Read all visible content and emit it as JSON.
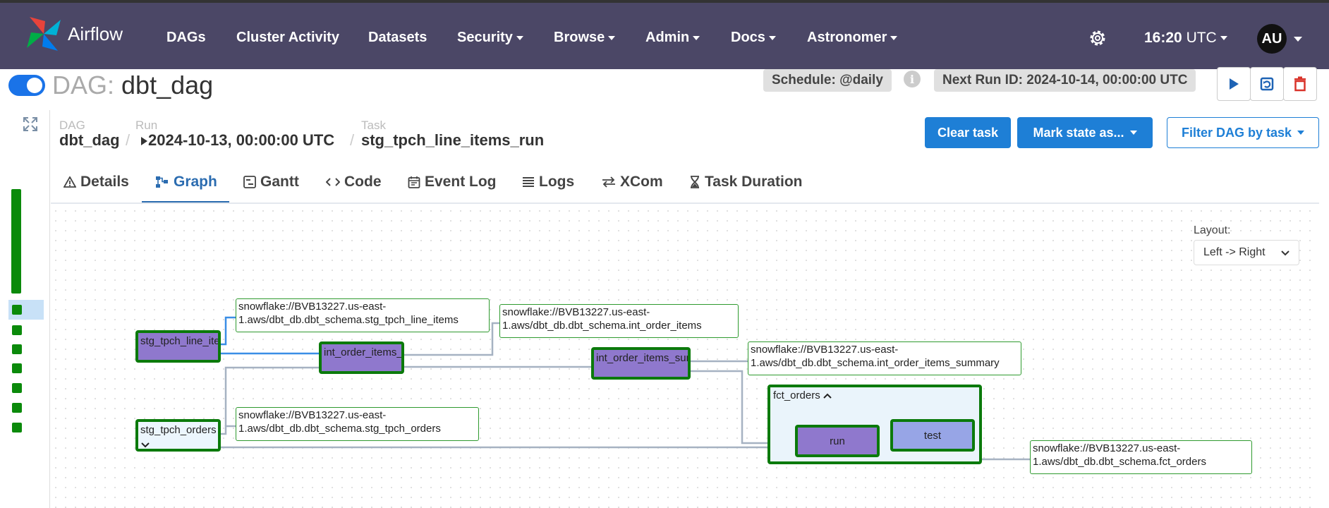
{
  "nav": {
    "brand": "Airflow",
    "items": [
      "DAGs",
      "Cluster Activity",
      "Datasets",
      "Security",
      "Browse",
      "Admin",
      "Docs",
      "Astronomer"
    ],
    "time": "16:20",
    "timezone": "UTC",
    "avatar_initials": "AU"
  },
  "dag": {
    "label": "DAG:",
    "name": "dbt_dag",
    "schedule": "Schedule: @daily",
    "next_run": "Next Run ID: 2024-10-14, 00:00:00 UTC"
  },
  "breadcrumb": {
    "dag_label": "DAG",
    "dag_value": "dbt_dag",
    "run_label": "Run",
    "run_value": "2024-10-13, 00:00:00 UTC",
    "task_label": "Task",
    "task_value": "stg_tpch_line_items_run",
    "separator": "/"
  },
  "actions": {
    "clear_task": "Clear task",
    "mark_state": "Mark state as...",
    "filter": "Filter DAG by task"
  },
  "tabs": [
    "Details",
    "Graph",
    "Gantt",
    "Code",
    "Event Log",
    "Logs",
    "XCom",
    "Task Duration"
  ],
  "layout": {
    "label": "Layout:",
    "value": "Left -> Right"
  },
  "graph": {
    "tasks": {
      "stg_line_items": "stg_tpch_line_items_run",
      "stg_orders": "stg_tpch_orders",
      "int_order_items": "int_order_items_run",
      "int_summary": "int_order_items_summary_run",
      "group": "fct_orders",
      "run": "run",
      "test": "test"
    },
    "datasets": {
      "stg_line_items": "snowflake://BVB13227.us-east-1.aws/dbt_db.dbt_schema.stg_tpch_line_items",
      "stg_orders": "snowflake://BVB13227.us-east-1.aws/dbt_db.dbt_schema.stg_tpch_orders",
      "int_order_items": "snowflake://BVB13227.us-east-1.aws/dbt_db.dbt_schema.int_order_items",
      "int_summary": "snowflake://BVB13227.us-east-1.aws/dbt_db.dbt_schema.int_order_items_summary",
      "fct_orders": "snowflake://BVB13227.us-east-1.aws/dbt_db.dbt_schema.fct_orders"
    }
  },
  "colors": {
    "navbar": "#4b4766",
    "primary": "#1e7fd6",
    "success_border": "#0b7a0b",
    "task_fill": "#8f78cd",
    "edge": "#a6b2c2",
    "edge_highlight": "#3a8ee6"
  }
}
